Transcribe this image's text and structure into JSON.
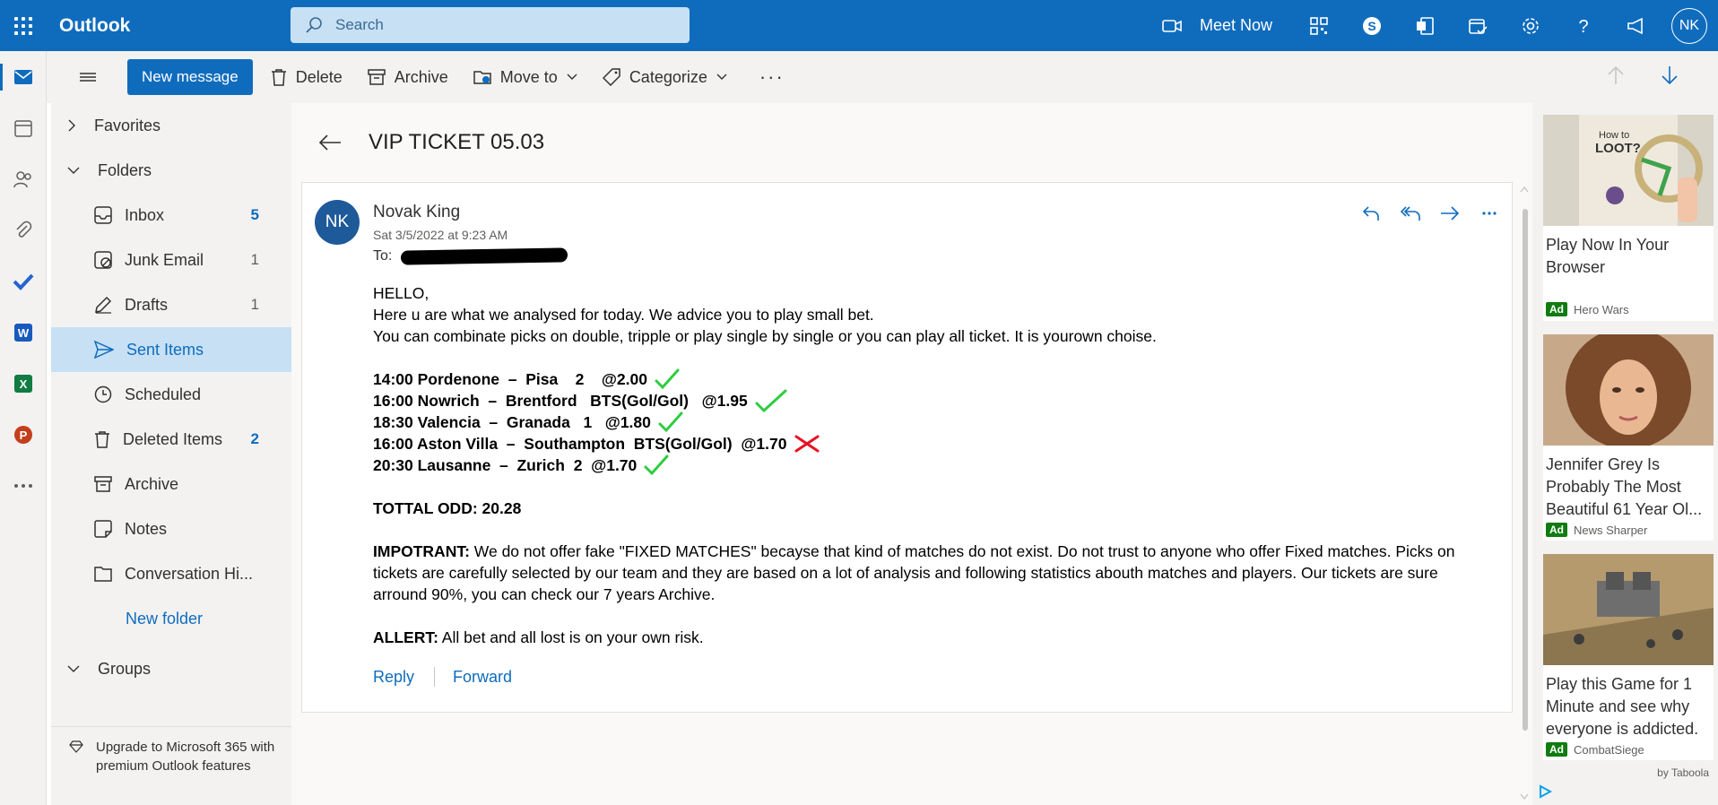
{
  "topbar": {
    "app_name": "Outlook",
    "search_placeholder": "Search",
    "meet_now": "Meet Now",
    "user_initials": "NK"
  },
  "commands": {
    "new_message": "New message",
    "delete": "Delete",
    "archive": "Archive",
    "move_to": "Move to",
    "categorize": "Categorize",
    "more": "···"
  },
  "folders": {
    "favorites": "Favorites",
    "folders": "Folders",
    "items": [
      {
        "label": "Inbox",
        "count": "5"
      },
      {
        "label": "Junk Email",
        "count": "1"
      },
      {
        "label": "Drafts",
        "count": "1"
      },
      {
        "label": "Sent Items",
        "count": ""
      },
      {
        "label": "Scheduled",
        "count": ""
      },
      {
        "label": "Deleted Items",
        "count": "2"
      },
      {
        "label": "Archive",
        "count": ""
      },
      {
        "label": "Notes",
        "count": ""
      },
      {
        "label": "Conversation Hi...",
        "count": ""
      }
    ],
    "new_folder": "New folder",
    "groups": "Groups",
    "upgrade": "Upgrade to Microsoft 365 with premium Outlook features"
  },
  "message": {
    "subject": "VIP TICKET 05.03",
    "sender_initials": "NK",
    "sender_name": "Novak King",
    "date": "Sat 3/5/2022 at 9:23 AM",
    "to_label": "To:",
    "greeting": "HELLO,",
    "line1": "Here u are what we analysed for today. We advice you to play small bet.",
    "line2": "You can combinate picks on double, tripple or play single by single or you can play all ticket. It is yourown choise.",
    "picks": [
      {
        "text": "14:00 Pordenone  –  Pisa    2    @2.00",
        "result": "win"
      },
      {
        "text": "16:00 Nowrich  –  Brentford   BTS(Gol/Gol)   @1.95",
        "result": "win"
      },
      {
        "text": "18:30 Valencia  –  Granada   1   @1.80",
        "result": "win"
      },
      {
        "text": "16:00 Aston Villa  –  Southampton  BTS(Gol/Gol)  @1.70",
        "result": "loss"
      },
      {
        "text": "20:30 Lausanne  –  Zurich  2  @1.70",
        "result": "win"
      }
    ],
    "total_odd": "TOTTAL ODD: 20.28",
    "important_label": "IMPOTRANT:",
    "important_text": " We do not offer fake \"FIXED MATCHES\" becayse that kind of matches do not exist. Do not trust to anyone who offer Fixed matches. Picks on tickets are carefully selected by our team and they are based on a lot of analysis and following statistics abouth matches and players. Our tickets are sure arround 90%, you can check our 7 years Archive.",
    "alert_label": "ALLERT:",
    "alert_text": " All bet and all lost is on your own risk.",
    "reply": "Reply",
    "forward": "Forward"
  },
  "ads": [
    {
      "title": "Play Now In Your Browser",
      "badge": "Ad",
      "source": "Hero Wars"
    },
    {
      "title": "Jennifer Grey Is Probably The Most Beautiful 61 Year Ol...",
      "badge": "Ad",
      "source": "News Sharper"
    },
    {
      "title": "Play this Game for 1 Minute and see why everyone is addicted.",
      "badge": "Ad",
      "source": "CombatSiege"
    }
  ],
  "taboola": "by Taboola",
  "colors": {
    "brand": "#0f6cbd",
    "check": "#2ecc40",
    "cross": "#e81123"
  }
}
